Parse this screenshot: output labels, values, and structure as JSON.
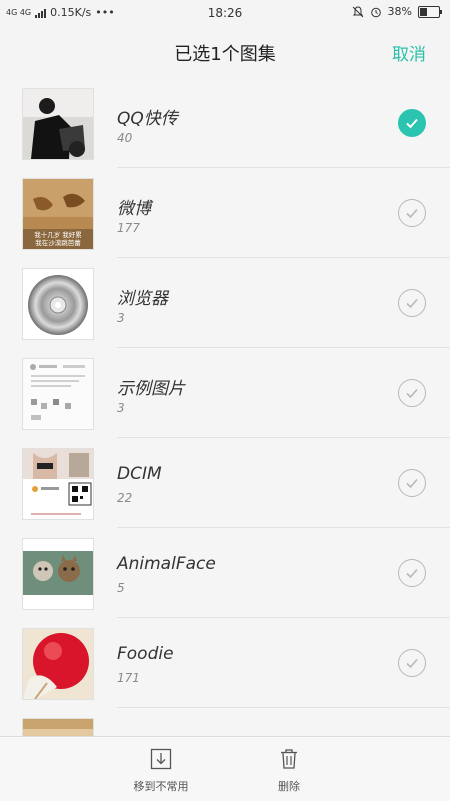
{
  "status": {
    "network": "4G 4G",
    "speed": "0.15K/s",
    "time": "18:26",
    "battery": "38%"
  },
  "header": {
    "title": "已选1个图集",
    "cancel_label": "取消"
  },
  "albums": [
    {
      "name": "QQ快传",
      "count": "40",
      "selected": true
    },
    {
      "name": "微博",
      "count": "177",
      "selected": false
    },
    {
      "name": "浏览器",
      "count": "3",
      "selected": false
    },
    {
      "name": "示例图片",
      "count": "3",
      "selected": false
    },
    {
      "name": "DCIM",
      "count": "22",
      "selected": false
    },
    {
      "name": "AnimalFace",
      "count": "5",
      "selected": false
    },
    {
      "name": "Foodie",
      "count": "171",
      "selected": false
    }
  ],
  "weibo_thumb_caption": "我十几岁 我好累\n我在沙漠跳芭蕾",
  "bottom_bar": {
    "move_label": "移到不常用",
    "delete_label": "删除"
  },
  "accent": "#2ac4b0"
}
